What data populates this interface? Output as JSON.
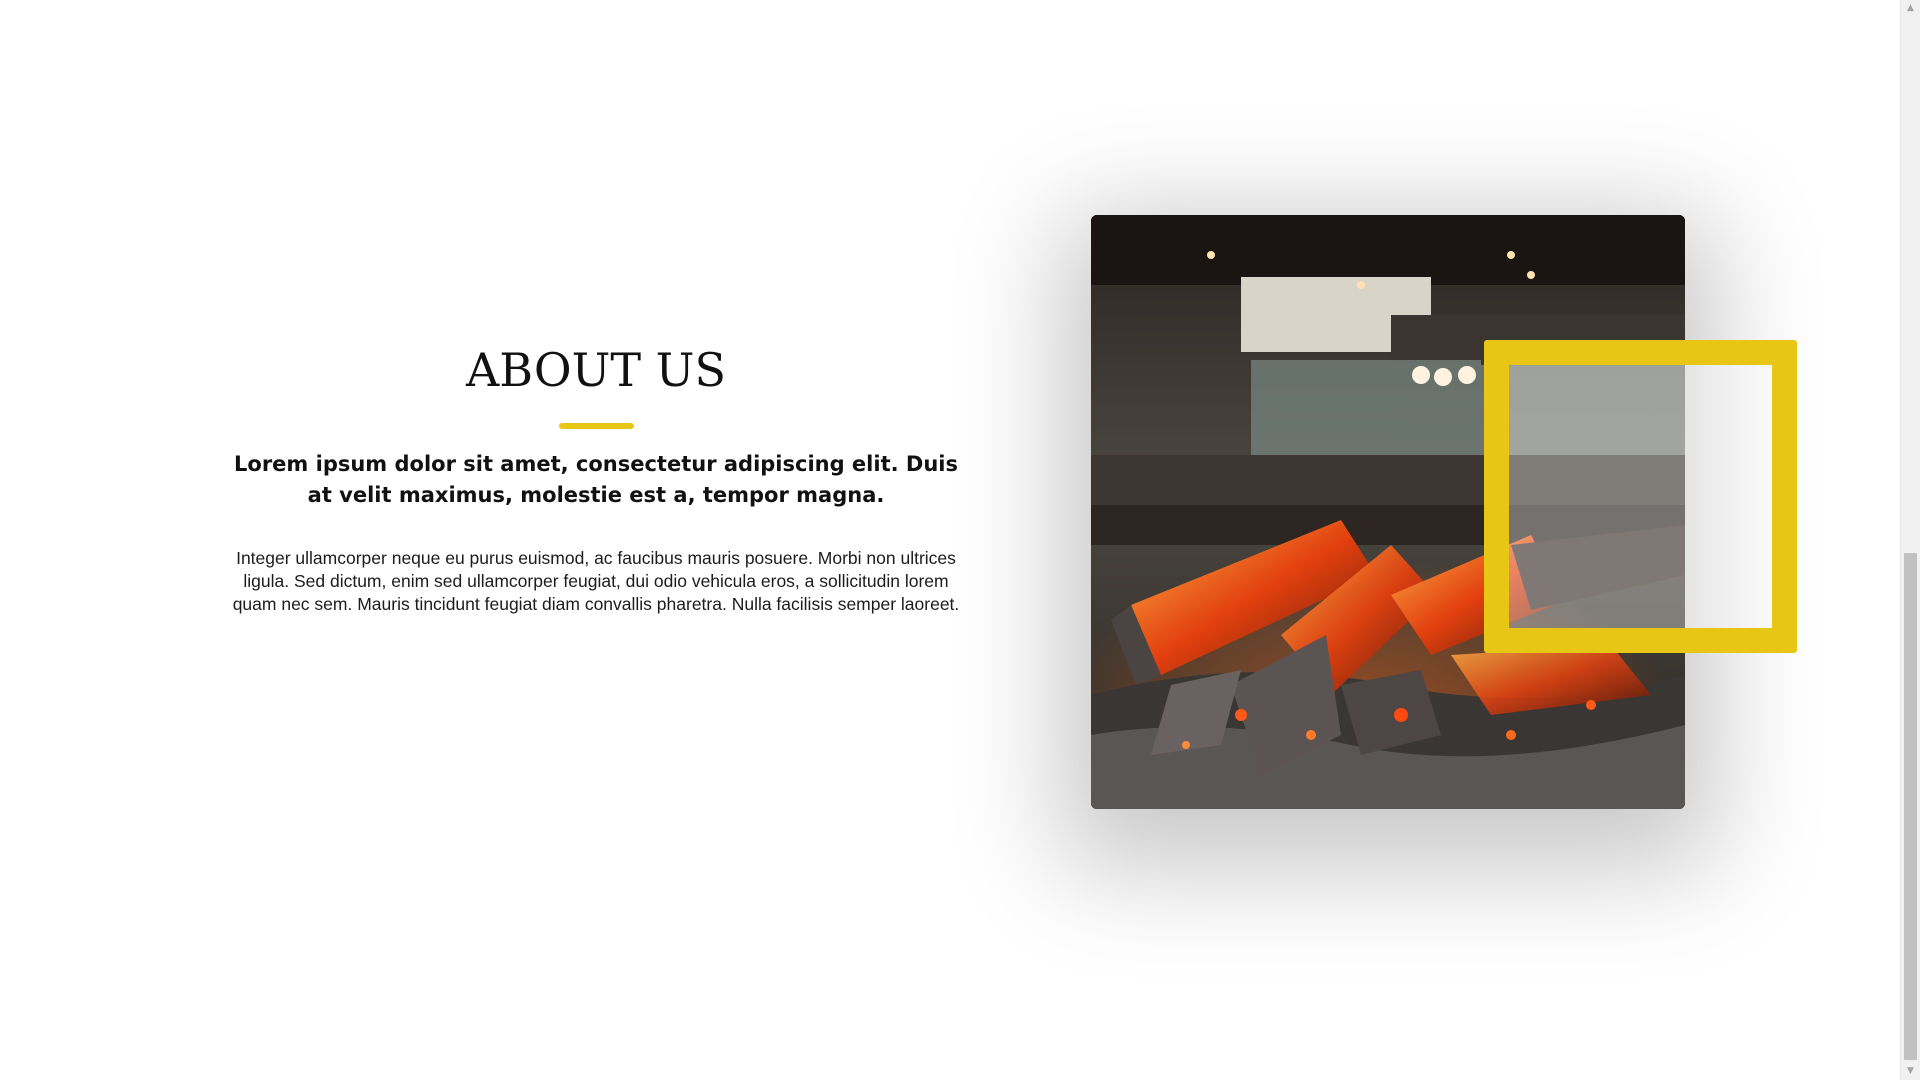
{
  "about": {
    "heading": "ABOUT US",
    "lead": "Lorem ipsum dolor sit amet, consectetur adipiscing elit. Duis at velit maximus, molestie est a, tempor magna.",
    "body": "Integer ullamcorper neque eu purus euismod, ac faucibus mauris posuere. Morbi non ultrices ligula. Sed dictum, enim sed ullamcorper feugiat, dui odio vehicula eros, a sollicitudin lorem quam nec sem. Mauris tincidunt feugiat diam convallis pharetra. Nulla facilisis semper laoreet."
  },
  "image": {
    "icon": "restaurant-fireplace-photo"
  },
  "scrollbar": {
    "up_icon": "▲",
    "down_icon": "▼",
    "position": 0.51
  },
  "colors": {
    "accent": "#e8c615",
    "heading": "#111111",
    "background": "#ffffff"
  }
}
